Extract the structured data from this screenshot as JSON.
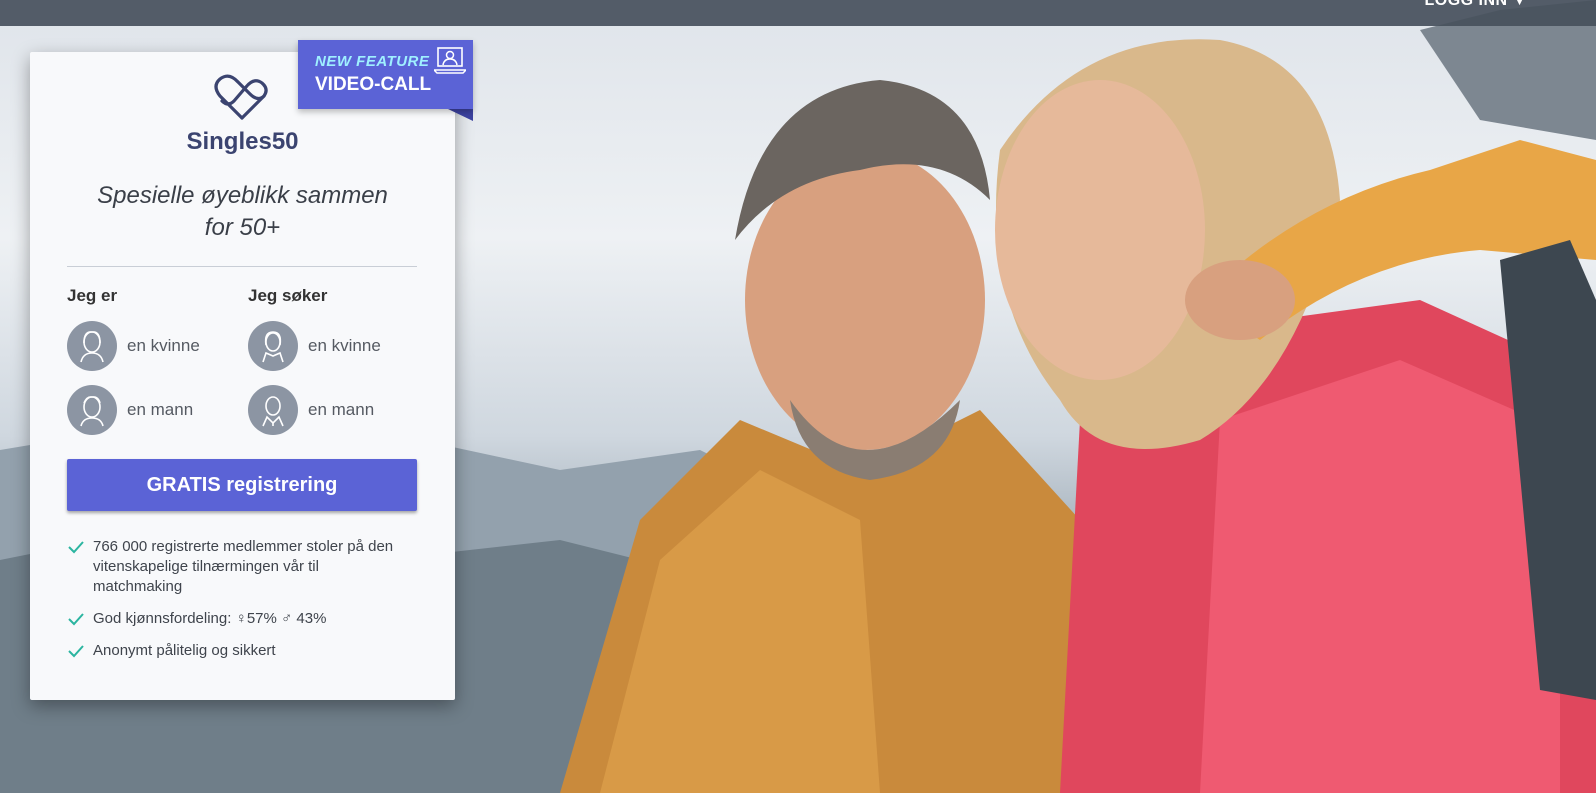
{
  "header": {
    "login_label": "LOGG INN"
  },
  "feature_badge": {
    "line1": "NEW FEATURE",
    "line2": "VIDEO-CALL"
  },
  "brand": {
    "name": "Singles50"
  },
  "tagline": {
    "line1": "Spesielle øyeblikk sammen",
    "line2": "for 50+"
  },
  "form": {
    "i_am": {
      "title": "Jeg er",
      "options": [
        {
          "label": "en kvinne",
          "icon": "woman-icon"
        },
        {
          "label": "en mann",
          "icon": "man-icon"
        }
      ]
    },
    "seeking": {
      "title": "Jeg søker",
      "options": [
        {
          "label": "en kvinne",
          "icon": "woman-icon"
        },
        {
          "label": "en mann",
          "icon": "man-icon"
        }
      ]
    },
    "cta_label": "GRATIS registrering"
  },
  "features": [
    "766 000 registrerte medlemmer stoler på den vitenskapelige tilnærmingen vår til matchmaking",
    "God kjønnsfordeling: ♀57% ♂ 43%",
    "Anonymt pålitelig og sikkert"
  ],
  "colors": {
    "accent": "#5b63d6",
    "check": "#2bb5a0",
    "brand_text": "#3b4470",
    "badge_text": "#9ff0ff"
  }
}
